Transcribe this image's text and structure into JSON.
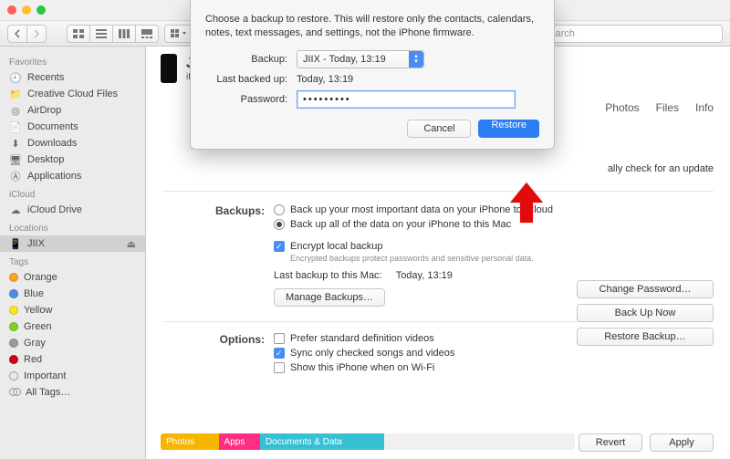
{
  "window": {
    "title": "JIIX"
  },
  "toolbar": {
    "search_placeholder": "Search"
  },
  "sidebar": {
    "favorites_header": "Favorites",
    "icloud_header": "iCloud",
    "locations_header": "Locations",
    "tags_header": "Tags",
    "favorites": [
      {
        "label": "Recents",
        "icon": "clock"
      },
      {
        "label": "Creative Cloud Files",
        "icon": "folder"
      },
      {
        "label": "AirDrop",
        "icon": "airdrop"
      },
      {
        "label": "Documents",
        "icon": "doc"
      },
      {
        "label": "Downloads",
        "icon": "download"
      },
      {
        "label": "Desktop",
        "icon": "desktop"
      },
      {
        "label": "Applications",
        "icon": "apps"
      }
    ],
    "icloud": [
      {
        "label": "iCloud Drive",
        "icon": "cloud"
      }
    ],
    "locations": [
      {
        "label": "JIIX",
        "icon": "phone",
        "selected": true
      }
    ],
    "tags": [
      {
        "label": "Orange",
        "color": "#f5a623"
      },
      {
        "label": "Blue",
        "color": "#4a90e2"
      },
      {
        "label": "Yellow",
        "color": "#f8e71c"
      },
      {
        "label": "Green",
        "color": "#7ed321"
      },
      {
        "label": "Gray",
        "color": "#9b9b9b"
      },
      {
        "label": "Red",
        "color": "#d0021b"
      }
    ],
    "important": "Important",
    "all_tags": "All Tags…"
  },
  "device": {
    "name": "JIIX",
    "subtitle": "iPho"
  },
  "tabs": {
    "photos": "Photos",
    "files": "Files",
    "info": "Info"
  },
  "software": {
    "update_text": "ally check for an update"
  },
  "backups": {
    "label": "Backups:",
    "radio_icloud": "Back up your most important data on your iPhone to iCloud",
    "radio_mac": "Back up all of the data on your iPhone to this Mac",
    "encrypt_label": "Encrypt local backup",
    "encrypt_note": "Encrypted backups protect passwords and sensitive personal data.",
    "last_backup_label": "Last backup to this Mac:",
    "last_backup_value": "Today, 13:19",
    "manage_btn": "Manage Backups…",
    "change_pw_btn": "Change Password…",
    "backup_now_btn": "Back Up Now",
    "restore_btn": "Restore Backup…"
  },
  "options": {
    "label": "Options:",
    "sd": "Prefer standard definition videos",
    "sync": "Sync only checked songs and videos",
    "wifi": "Show this iPhone when on Wi-Fi"
  },
  "storage": {
    "photos": "Photos",
    "apps": "Apps",
    "docs": "Documents & Data"
  },
  "footer": {
    "revert": "Revert",
    "apply": "Apply"
  },
  "modal": {
    "message": "Choose a backup to restore. This will restore only the contacts, calendars, notes, text messages, and settings, not the iPhone firmware.",
    "backup_label": "Backup:",
    "backup_value": "JIIX - Today, 13:19",
    "last_label": "Last backed up:",
    "last_value": "Today, 13:19",
    "password_label": "Password:",
    "password_value": "•••••••••",
    "cancel": "Cancel",
    "restore": "Restore"
  }
}
